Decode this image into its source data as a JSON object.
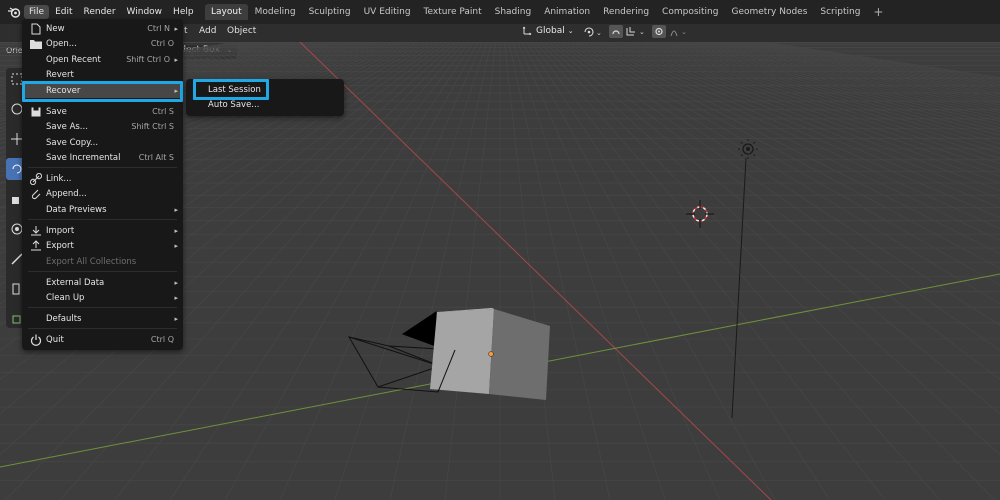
{
  "menubar": {
    "items": [
      "File",
      "Edit",
      "Render",
      "Window",
      "Help"
    ]
  },
  "workspaces": {
    "tabs": [
      "Layout",
      "Modeling",
      "Sculpting",
      "UV Editing",
      "Texture Paint",
      "Shading",
      "Animation",
      "Rendering",
      "Compositing",
      "Geometry Nodes",
      "Scripting"
    ],
    "active": "Layout",
    "add_label": "+"
  },
  "viewport_header": {
    "orientation_label": "Orie",
    "menu_partial": "t",
    "add_label": "Add",
    "object_label": "Object",
    "select_box_label": "elect Box",
    "transform_orientation": "Global"
  },
  "file_menu": {
    "items": [
      {
        "label": "New",
        "shortcut": "Ctrl N",
        "submenu": true,
        "icon": "new-file-icon"
      },
      {
        "label": "Open...",
        "shortcut": "Ctrl O",
        "icon": "folder-icon"
      },
      {
        "label": "Open Recent",
        "shortcut": "Shift Ctrl O",
        "submenu": true
      },
      {
        "label": "Revert",
        "shortcut": ""
      },
      {
        "label": "Recover",
        "shortcut": "",
        "submenu": true
      },
      {
        "label": "Save",
        "shortcut": "Ctrl S",
        "icon": "save-icon"
      },
      {
        "label": "Save As...",
        "shortcut": "Shift Ctrl S"
      },
      {
        "label": "Save Copy...",
        "shortcut": ""
      },
      {
        "label": "Save Incremental",
        "shortcut": "Ctrl Alt S"
      },
      {
        "label": "Link...",
        "shortcut": "",
        "icon": "link-icon"
      },
      {
        "label": "Append...",
        "shortcut": "",
        "icon": "append-icon"
      },
      {
        "label": "Data Previews",
        "shortcut": "",
        "submenu": true
      },
      {
        "label": "Import",
        "shortcut": "",
        "submenu": true,
        "icon": "import-icon"
      },
      {
        "label": "Export",
        "shortcut": "",
        "submenu": true,
        "icon": "export-icon"
      },
      {
        "label": "Export All Collections",
        "shortcut": "",
        "disabled": true
      },
      {
        "label": "External Data",
        "shortcut": "",
        "submenu": true
      },
      {
        "label": "Clean Up",
        "shortcut": "",
        "submenu": true
      },
      {
        "label": "Defaults",
        "shortcut": "",
        "submenu": true
      },
      {
        "label": "Quit",
        "shortcut": "Ctrl Q",
        "icon": "power-icon"
      }
    ]
  },
  "recover_menu": {
    "items": [
      "Last Session",
      "Auto Save..."
    ]
  },
  "colors": {
    "highlight_box": "#1fa8e6",
    "menu_bg": "#181818",
    "viewport_bg": "#3d3d3d",
    "x_axis": "#b8494f",
    "y_axis": "#78a03c"
  }
}
